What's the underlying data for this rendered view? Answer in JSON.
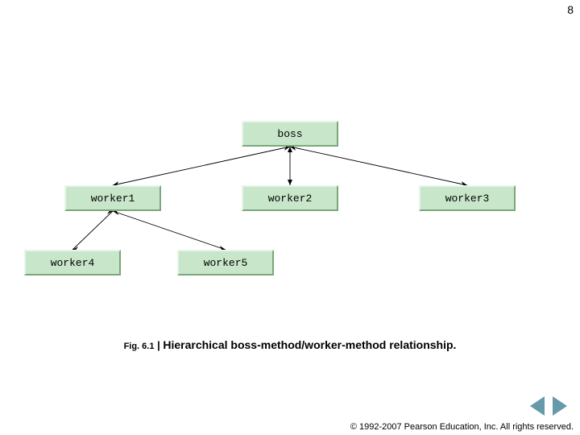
{
  "page_number": "8",
  "diagram": {
    "nodes": {
      "boss": {
        "label": "boss"
      },
      "worker1": {
        "label": "worker1"
      },
      "worker2": {
        "label": "worker2"
      },
      "worker3": {
        "label": "worker3"
      },
      "worker4": {
        "label": "worker4"
      },
      "worker5": {
        "label": "worker5"
      }
    },
    "edges": [
      {
        "from": "boss",
        "to": "worker1",
        "bidirectional": true
      },
      {
        "from": "boss",
        "to": "worker2",
        "bidirectional": true
      },
      {
        "from": "boss",
        "to": "worker3",
        "bidirectional": true
      },
      {
        "from": "worker1",
        "to": "worker4",
        "bidirectional": true
      },
      {
        "from": "worker1",
        "to": "worker5",
        "bidirectional": true
      }
    ]
  },
  "caption": {
    "label": "Fig. 6.1",
    "separator": "|",
    "title": "Hierarchical boss-method/worker-method relationship."
  },
  "copyright": "© 1992-2007 Pearson Education, Inc.  All rights reserved."
}
